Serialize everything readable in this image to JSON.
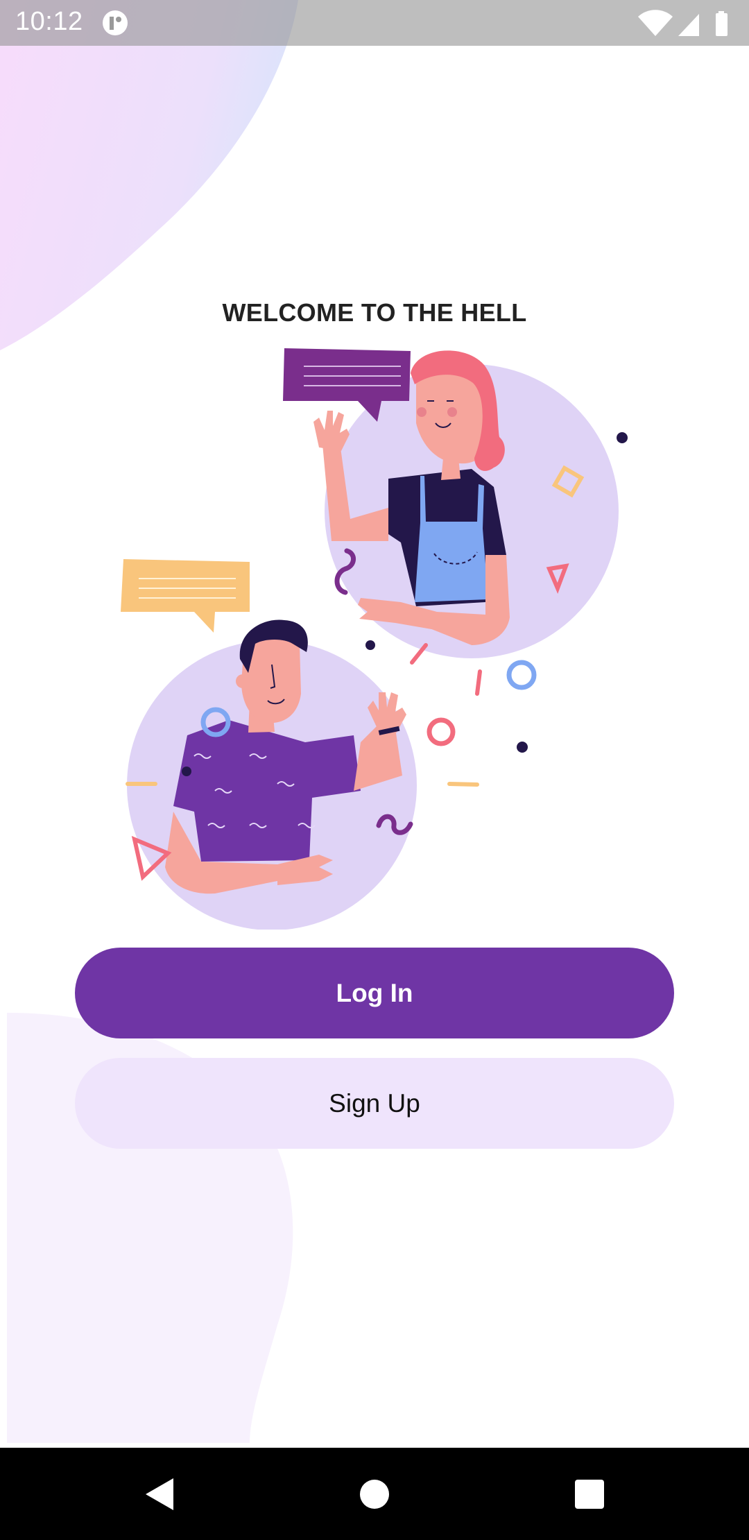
{
  "status_bar": {
    "time": "10:12",
    "icons": [
      "app-notification-icon",
      "wifi-icon",
      "cellular-signal-icon",
      "battery-icon"
    ]
  },
  "welcome": {
    "title": "WELCOME TO THE HELL"
  },
  "illustration": {
    "subject": "two-people-chatting-illustration"
  },
  "actions": {
    "login_label": "Log In",
    "signup_label": "Sign Up"
  },
  "navigation": {
    "buttons": [
      "back-icon",
      "home-icon",
      "recents-icon"
    ]
  },
  "colors": {
    "primary": "#6f35a5",
    "primary_light": "#efe4fc",
    "title_text": "#222222",
    "nav_bar": "#000000"
  }
}
